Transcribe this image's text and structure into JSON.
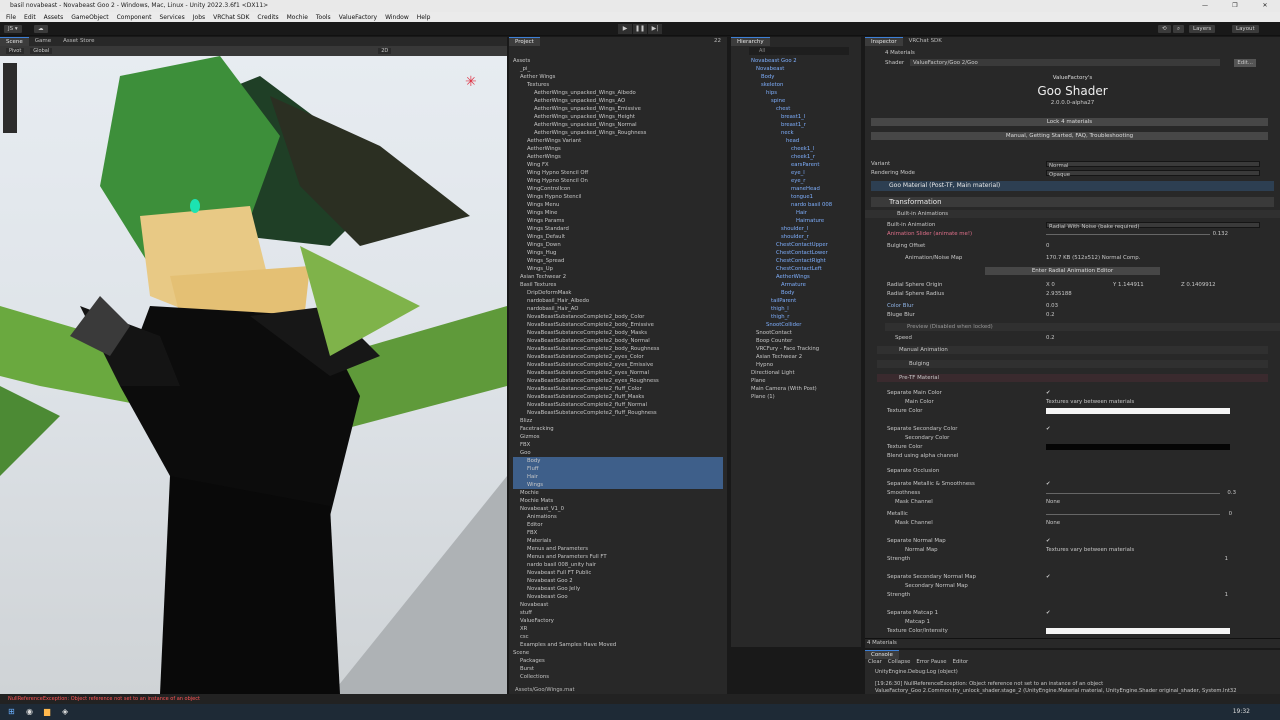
{
  "window": {
    "title": "basil novabeast - Novabeast Goo 2 - Windows, Mac, Linux - Unity 2022.3.6f1 <DX11>",
    "controls": [
      "—",
      "❐",
      "✕"
    ]
  },
  "menu": [
    "File",
    "Edit",
    "Assets",
    "GameObject",
    "Component",
    "Services",
    "Jobs",
    "VRChat SDK",
    "Credits",
    "Mochie",
    "Tools",
    "ValueFactory",
    "Window",
    "Help"
  ],
  "toolbar": {
    "account": "JS ▾",
    "layers": "Layers",
    "layout": "Layout"
  },
  "scene": {
    "tabs": [
      "Scene",
      "Game",
      "Asset Store"
    ],
    "pivot": "Pivot",
    "global": "Global",
    "mode2d": "2D"
  },
  "project": {
    "tab": "Project",
    "count": "22",
    "items": [
      "Assets",
      "_pi_",
      "Aether Wings",
      "Textures",
      "AetherWings_unpacked_Wings_Albedo",
      "AetherWings_unpacked_Wings_AO",
      "AetherWings_unpacked_Wings_Emissive",
      "AetherWings_unpacked_Wings_Height",
      "AetherWings_unpacked_Wings_Normal",
      "AetherWings_unpacked_Wings_Roughness",
      "AetherWings Variant",
      "AetherWings",
      "AetherWings",
      "Wing FX",
      "Wing Hypno Stencil Off",
      "Wing Hypno Stencil On",
      "WingControlIcon",
      "Wings Hypno Stencil",
      "Wings Menu",
      "Wings Mine",
      "Wings Params",
      "Wings Standard",
      "Wings_Default",
      "Wings_Down",
      "Wings_Hug",
      "Wings_Spread",
      "Wings_Up",
      "Asian Techwear 2",
      "Basil Textures",
      "DripDeformMask",
      "nardobasil_Hair_Albedo",
      "nardobasil_Hair_AO",
      "NovaBeastSubstanceComplete2_body_Color",
      "NovaBeastSubstanceComplete2_body_Emissive",
      "NovaBeastSubstanceComplete2_body_Masks",
      "NovaBeastSubstanceComplete2_body_Normal",
      "NovaBeastSubstanceComplete2_body_Roughness",
      "NovaBeastSubstanceComplete2_eyes_Color",
      "NovaBeastSubstanceComplete2_eyes_Emissive",
      "NovaBeastSubstanceComplete2_eyes_Normal",
      "NovaBeastSubstanceComplete2_eyes_Roughness",
      "NovaBeastSubstanceComplete2_fluff_Color",
      "NovaBeastSubstanceComplete2_fluff_Masks",
      "NovaBeastSubstanceComplete2_fluff_Normal",
      "NovaBeastSubstanceComplete2_fluff_Roughness",
      "Blizz",
      "Facetracking",
      "Gizmos",
      "FBX",
      "Goo",
      "Body",
      "Fluff",
      "Hair",
      "Wings",
      "Mochie",
      "Mochie Mats",
      "Novabeast_V1_0",
      "Animations",
      "Editor",
      "FBX",
      "Materials",
      "Menus and Parameters",
      "Menus and Parameters Full FT",
      "nardo basil 008_unity hair",
      "Novabeast Full FT Public",
      "Novabeast Goo 2",
      "Novabeast Goo Jelly",
      "Novabeast Goo",
      "Novabeast",
      "stuff",
      "ValueFactory",
      "XR",
      "csc",
      "Examples and Samples Have Moved",
      "Scene",
      "Packages",
      "Burst",
      "Collections",
      "Custom NUnit"
    ],
    "footer": "Assets/Goo/Wings.mat"
  },
  "hierarchy": {
    "tab": "Hierarchy",
    "search": "All",
    "items": [
      "Novabeast Goo 2",
      "Novabeast",
      "Body",
      "skeleton",
      "hips",
      "spine",
      "chest",
      "breast1_l",
      "breast1_r",
      "neck",
      "head",
      "cheek1_l",
      "cheek1_r",
      "earsParent",
      "eye_l",
      "eye_r",
      "maneHead",
      "tongue1",
      "nardo basil 008",
      "Hair",
      "Hairnature",
      "shoulder_l",
      "shoulder_r",
      "ChestContactUpper",
      "ChestContactLower",
      "ChestContactRight",
      "ChestContactLeft",
      "AetherWings",
      "Armature",
      "Body",
      "tailParent",
      "thigh_l",
      "thigh_r",
      "SnootCollider",
      "SnootContact",
      "Boop Counter",
      "VRCFury - Face Tracking",
      "Asian Techwear 2",
      "Hypno",
      "Directional Light",
      "Plane",
      "Main Camera (With Post)",
      "Plane (1)"
    ]
  },
  "inspector": {
    "tabs": [
      "Inspector",
      "VRChat SDK"
    ],
    "materials_count": "4 Materials",
    "shader_label": "Shader",
    "shader_value": "ValueFactory/Goo 2/Goo",
    "edit": "Edit...",
    "brand": "ValueFactory's",
    "title": "Goo Shader",
    "version": "2.0.0.0-alpha27",
    "lock_btn": "Lock 4 materials",
    "manual_btn": "Manual, Getting Started, FAQ, Troubleshooting",
    "variant_label": "Variant",
    "variant_value": "Normal",
    "rendering_label": "Rendering Mode",
    "rendering_value": "Opaque",
    "goo_material": "Goo Material (Post-TF, Main material)",
    "transformation": "Transformation",
    "builtin_anims": "Built-in Animations",
    "builtin_anim_label": "Built-in Animation",
    "builtin_anim_value": "Radial With Noise (bake required)",
    "anim_slider_label": "Animation Slider (animate me!)",
    "anim_slider_value": "0.132",
    "bulging_offset_label": "Bulging Offset",
    "bulging_offset_value": "0",
    "noise_map_label": "Animation/Noise Map",
    "noise_map_value": "170.7 KB (512x512) Normal Comp.",
    "enter_editor": "Enter Radial Animation Editor",
    "origin_label": "Radial Sphere Origin",
    "origin_x": "X 0",
    "origin_y": "Y 1.144911",
    "origin_z": "Z 0.1409912",
    "radius_label": "Radial Sphere Radius",
    "radius_value": "2.935188",
    "color_blur_label": "Color Blur",
    "color_blur_value": "0.03",
    "bulge_blur_label": "Bluge Blur",
    "bulge_blur_value": "0.2",
    "preview": "Preview (Disabled when locked)",
    "speed_label": "Speed",
    "speed_value": "0.2",
    "manual_animation": "Manual Animation",
    "bulging": "Bulging",
    "pre_tf": "Pre-TF Material",
    "sep_main": "Separate Main Color",
    "main_color": "Main Color",
    "main_val": "Textures vary between materials",
    "texture_color": "Texture Color",
    "sep_secondary": "Separate Secondary Color",
    "secondary_color": "Secondary Color",
    "texture_color2": "Texture Color",
    "blend_alpha": "Blend using alpha channel",
    "sep_occlusion": "Separate Occlusion",
    "sep_metal": "Separate Metallic & Smoothness",
    "smoothness": "Smoothness",
    "smooth_val": "0.3",
    "mask_channel": "Mask Channel",
    "none": "None",
    "metallic": "Metallic",
    "metallic_val": "0",
    "mask_channel2": "Mask Channel",
    "none2": "None",
    "sep_normal": "Separate Normal Map",
    "normal_map": "Normal Map",
    "normal_val": "Textures vary between materials",
    "strength": "Strength",
    "strength_val": "1",
    "sep_sec_normal": "Separate Secondary Normal Map",
    "sec_normal_map": "Secondary Normal Map",
    "strength2": "Strength",
    "strength2_val": "1",
    "sep_matcap": "Separate Matcap 1",
    "matcap": "Matcap 1",
    "tex_intensity": "Texture Color/Intensity",
    "footer": "4 Materials"
  },
  "console": {
    "tab": "Console",
    "buttons": [
      "Clear",
      "Collapse",
      "Error Pause",
      "Editor"
    ],
    "line1": "UnityEngine.Debug:Log (object)",
    "line2": "[19:26:30] NullReferenceException: Object reference not set to an instance of an object",
    "line3": "ValueFactory_Goo 2.Common.try_unlock_shader.stage_2 (UnityEngine.Material material, UnityEngine.Shader original_shader, System.Int32"
  },
  "status": "NullReferenceException: Object reference not set to an instance of an object",
  "clock": "19:32",
  "colors": {
    "accent": "#3d7fd6",
    "selection": "#3e5f8a",
    "panel": "#282828",
    "error": "#ff5555",
    "goo_black": "#0b0b0b",
    "goo_green": "#4fa23a"
  }
}
